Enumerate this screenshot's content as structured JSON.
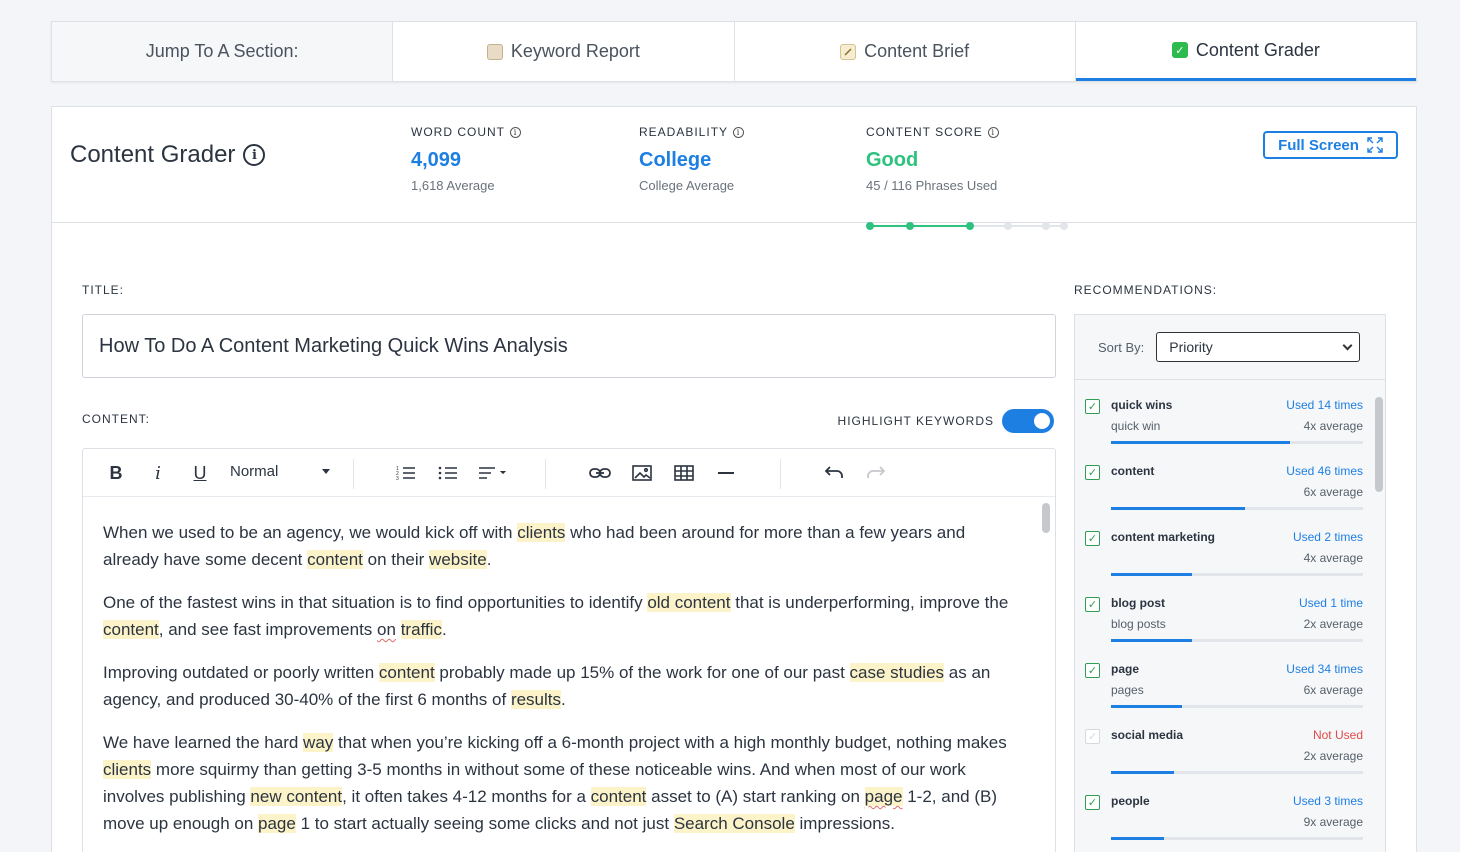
{
  "tabs": [
    {
      "label": "Jump To A Section:",
      "icon": ""
    },
    {
      "label": "Keyword Report",
      "icon": "clipboard-icon"
    },
    {
      "label": "Content Brief",
      "icon": "memo-icon"
    },
    {
      "label": "Content Grader",
      "icon": "check-icon",
      "active": true
    }
  ],
  "header": {
    "title": "Content Grader",
    "metrics": {
      "word_count": {
        "label": "WORD COUNT",
        "value": "4,099",
        "sub": "1,618 Average"
      },
      "readability": {
        "label": "READABILITY",
        "value": "College",
        "sub": "College Average"
      },
      "content_score": {
        "label": "CONTENT SCORE",
        "value": "Good",
        "sub": "45 / 116 Phrases Used",
        "level_fraction": 0.53
      }
    },
    "fullscreen_label": "Full Screen"
  },
  "editor": {
    "title_label": "TITLE:",
    "title_value": "How To Do A Content Marketing Quick Wins Analysis",
    "content_label": "CONTENT:",
    "highlight_label": "HIGHLIGHT KEYWORDS",
    "highlight_on": true,
    "format_value": "Normal"
  },
  "colors": {
    "accent": "#1e7fe3",
    "good": "#2ec27e",
    "keyword_highlight": "#fdf3c9",
    "not_used": "#e04a4a"
  },
  "recommendations": {
    "label": "RECOMMENDATIONS:",
    "sort_label": "Sort By:",
    "sort_value": "Priority",
    "items": [
      {
        "name": "quick wins",
        "variant": "quick win",
        "used": "Used 14 times",
        "avg": "4x average",
        "checked": true,
        "fill": 0.71
      },
      {
        "name": "content",
        "variant": "",
        "used": "Used 46 times",
        "avg": "6x average",
        "checked": true,
        "fill": 0.53
      },
      {
        "name": "content marketing",
        "variant": "",
        "used": "Used 2 times",
        "avg": "4x average",
        "checked": true,
        "fill": 0.32
      },
      {
        "name": "blog post",
        "variant": "blog posts",
        "used": "Used 1 time",
        "avg": "2x average",
        "checked": true,
        "fill": 0.32
      },
      {
        "name": "page",
        "variant": "pages",
        "used": "Used 34 times",
        "avg": "6x average",
        "checked": true,
        "fill": 0.28
      },
      {
        "name": "social media",
        "variant": "",
        "used": "Not Used",
        "avg": "2x average",
        "checked": false,
        "fill": 0.25
      },
      {
        "name": "people",
        "variant": "",
        "used": "Used 3 times",
        "avg": "9x average",
        "checked": true,
        "fill": 0.21
      }
    ]
  }
}
